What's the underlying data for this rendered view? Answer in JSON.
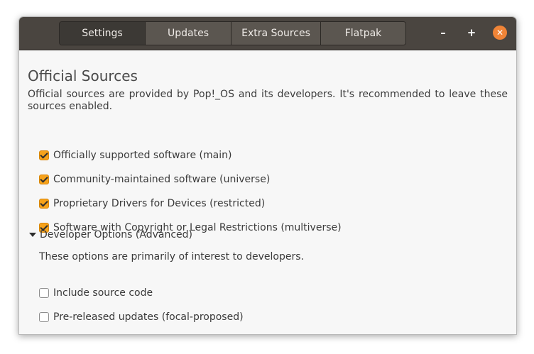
{
  "tabs": [
    {
      "label": "Settings",
      "active": true
    },
    {
      "label": "Updates",
      "active": false
    },
    {
      "label": "Extra Sources",
      "active": false
    },
    {
      "label": "Flatpak",
      "active": false
    }
  ],
  "window_controls": {
    "minimize": "–",
    "maximize": "+",
    "close": "✕"
  },
  "official": {
    "title": "Official Sources",
    "description": "Official sources are provided by Pop!_OS and its developers. It's recommended to leave these sources enabled.",
    "items": [
      {
        "label": "Officially supported software (main)",
        "checked": true
      },
      {
        "label": "Community-maintained software (universe)",
        "checked": true
      },
      {
        "label": "Proprietary Drivers for Devices (restricted)",
        "checked": true
      },
      {
        "label": "Software with Copyright or Legal Restrictions (multiverse)",
        "checked": true
      }
    ]
  },
  "developer": {
    "expander_label": "Developer Options (Advanced)",
    "description": "These options are primarily of interest to developers.",
    "items": [
      {
        "label": "Include source code",
        "checked": false
      },
      {
        "label": "Pre-released updates (focal-proposed)",
        "checked": false
      }
    ]
  },
  "colors": {
    "accent": "#f6a21b",
    "header": "#4a4540",
    "close_button": "#f08437"
  }
}
